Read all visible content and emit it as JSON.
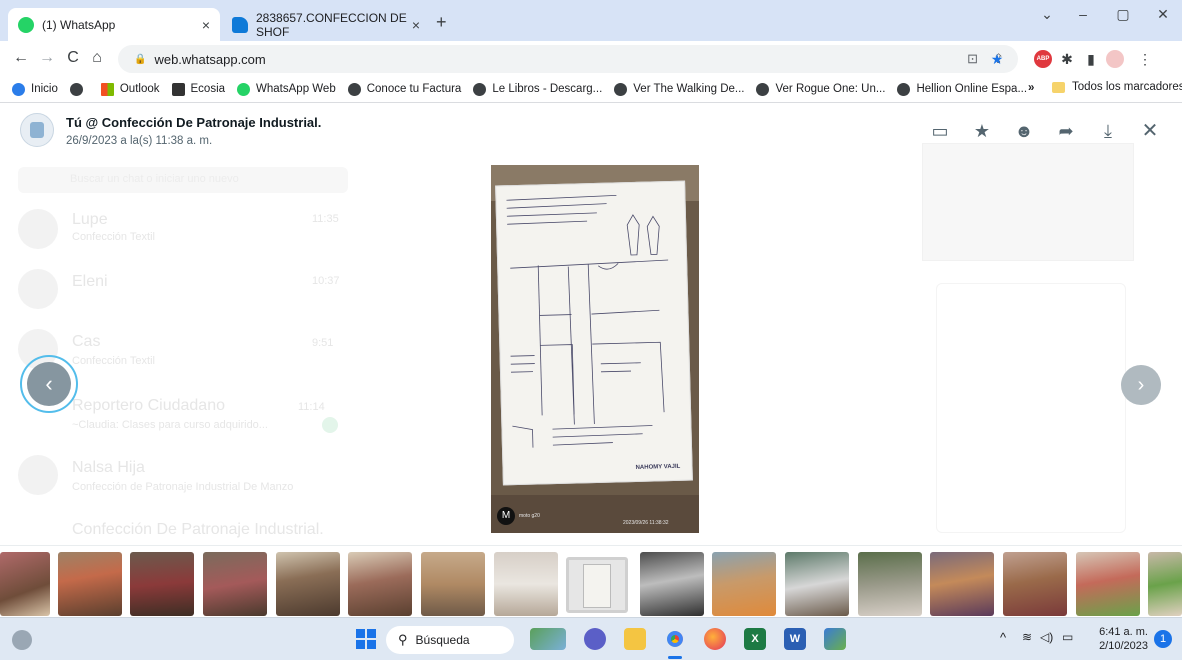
{
  "browser": {
    "tabs": [
      {
        "label": "(1) WhatsApp",
        "close": "×",
        "active": true
      },
      {
        "label": "2838657.CONFECCION DE SHOF",
        "close": "×",
        "active": false
      }
    ],
    "new_tab": "+",
    "window_controls": [
      "⌄",
      "–",
      "▢",
      "✕"
    ],
    "url": "web.whatsapp.com"
  },
  "bookmarks": {
    "items": [
      "Inicio",
      "Outlook",
      "Ecosia",
      "WhatsApp Web",
      "Conoce tu Factura",
      "Le Libros - Descarg...",
      "Ver The Walking De...",
      "Ver Rogue One: Un...",
      "Hellion Online Espa..."
    ],
    "overflow": "»",
    "all_bookmarks": "Todos los marcadores"
  },
  "viewer": {
    "title": "Tú @ Confección De Patronaje Industrial.",
    "subtitle": "26/9/2023 a la(s) 11:38 a. m.",
    "photo_caption": "moto g20",
    "photo_timestamp": "2023/09/26 11:38:32",
    "photo_stamp": "NAHOMY VAJIL"
  },
  "background_chats": {
    "search_placeholder": "Buscar un chat o iniciar uno nuevo",
    "chats": [
      {
        "name": "Lupe",
        "preview": "Confección Textil",
        "time": "11:35"
      },
      {
        "name": "Eleni",
        "preview": "",
        "time": "10:37"
      },
      {
        "name": "Cas",
        "preview": "Confección Textil",
        "time": "9:51"
      },
      {
        "name": "Reportero Ciudadano",
        "preview": "~Claudia: Clases para curso adquirido...",
        "time": "11:14"
      },
      {
        "name": "Nalsa Hija",
        "preview": "Confección de Patronaje Industrial De Manzo",
        "time": ""
      },
      {
        "name": "Confección De Patronaje Industrial.",
        "preview": "",
        "time": ""
      }
    ]
  },
  "thumbnails": {
    "count": 17,
    "selected_index": 8
  },
  "taskbar": {
    "search_label": "Búsqueda",
    "time": "6:41 a. m.",
    "date": "2/10/2023",
    "notification_count": "1"
  },
  "colors": {
    "tabstrip": "#d7e3f6",
    "whatsapp_green": "#25d366",
    "nav_ring": "#53bdeb",
    "taskbar": "#dfe8f3"
  }
}
